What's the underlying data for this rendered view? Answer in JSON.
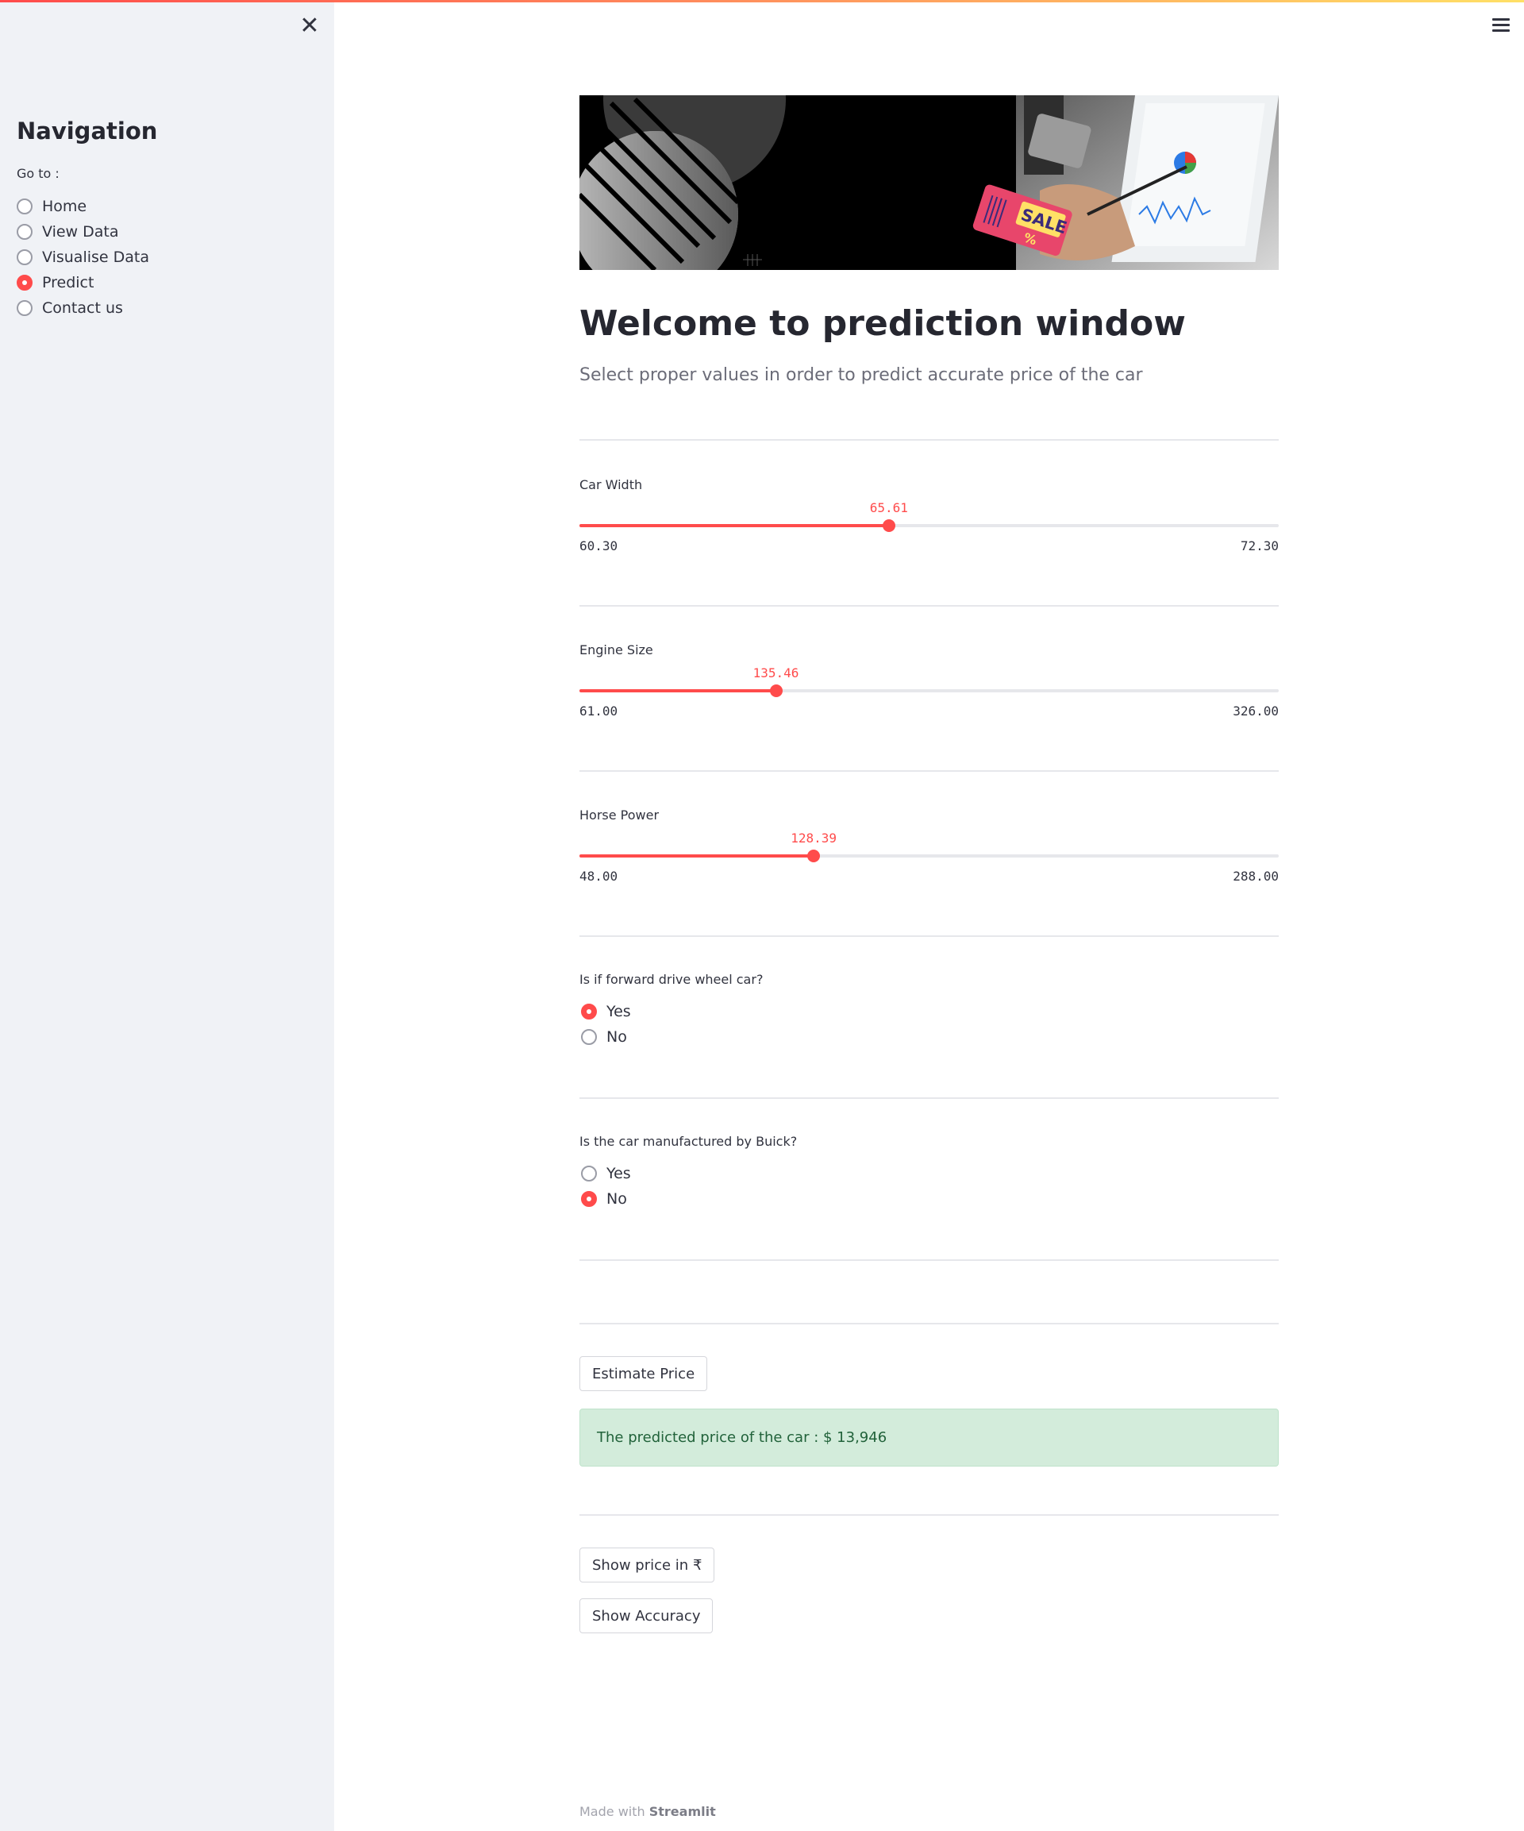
{
  "sidebar": {
    "close_icon": "close-icon",
    "title": "Navigation",
    "goto_label": "Go to :",
    "items": [
      {
        "label": "Home",
        "selected": false
      },
      {
        "label": "View Data",
        "selected": false
      },
      {
        "label": "Visualise Data",
        "selected": false
      },
      {
        "label": "Predict",
        "selected": true
      },
      {
        "label": "Contact us",
        "selected": false
      }
    ]
  },
  "header": {
    "menu_icon": "hamburger-menu-icon"
  },
  "main": {
    "banner_text": "SALE",
    "title": "Welcome to prediction window",
    "subtitle": "Select proper values in order to predict accurate price of the car",
    "sliders": [
      {
        "label": "Car Width",
        "value": "65.61",
        "min": "60.30",
        "max": "72.30"
      },
      {
        "label": "Engine Size",
        "value": "135.46",
        "min": "61.00",
        "max": "326.00"
      },
      {
        "label": "Horse Power",
        "value": "128.39",
        "min": "48.00",
        "max": "288.00"
      }
    ],
    "fwd_question": {
      "label": "Is if forward drive wheel car?",
      "options": [
        {
          "label": "Yes",
          "selected": true
        },
        {
          "label": "No",
          "selected": false
        }
      ]
    },
    "buick_question": {
      "label": "Is the car manufactured by Buick?",
      "options": [
        {
          "label": "Yes",
          "selected": false
        },
        {
          "label": "No",
          "selected": true
        }
      ]
    },
    "estimate_button": "Estimate Price",
    "result": "The predicted price of the car : $ 13,946",
    "inr_button": "Show price in ₹",
    "accuracy_button": "Show Accuracy"
  },
  "footer": {
    "prefix": "Made with",
    "brand": "Streamlit"
  },
  "colors": {
    "accent": "#ff4b4b",
    "sidebar_bg": "#f0f2f6",
    "success_bg": "#d3ecdb",
    "success_text": "#21623a"
  }
}
